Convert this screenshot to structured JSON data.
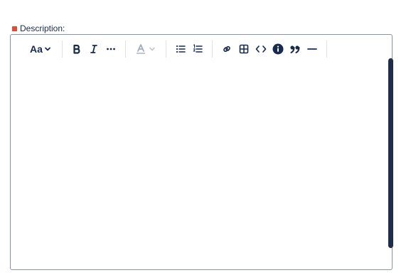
{
  "field": {
    "label": "Description:",
    "required": true
  },
  "toolbar": {
    "text_style_label": "Aa",
    "items": [
      {
        "name": "text-style",
        "icon": "chevron-down-icon"
      },
      {
        "name": "bold",
        "icon": "bold-icon"
      },
      {
        "name": "italic",
        "icon": "italic-icon"
      },
      {
        "name": "more-formatting",
        "icon": "more-icon"
      },
      {
        "name": "text-color",
        "icon": "text-color-icon",
        "disabled": true
      },
      {
        "name": "bullet-list",
        "icon": "bullet-list-icon"
      },
      {
        "name": "numbered-list",
        "icon": "numbered-list-icon"
      },
      {
        "name": "link",
        "icon": "link-icon"
      },
      {
        "name": "table",
        "icon": "table-icon"
      },
      {
        "name": "code",
        "icon": "code-icon"
      },
      {
        "name": "info-panel",
        "icon": "info-icon"
      },
      {
        "name": "quote",
        "icon": "quote-icon"
      },
      {
        "name": "divider",
        "icon": "horizontal-rule-icon"
      }
    ]
  },
  "editor": {
    "content": ""
  },
  "colors": {
    "text": "#172b4d",
    "required": "#e5493a",
    "border": "#8993a4",
    "scrollbar": "#1f2c4a",
    "disabled": "#a5adba"
  }
}
